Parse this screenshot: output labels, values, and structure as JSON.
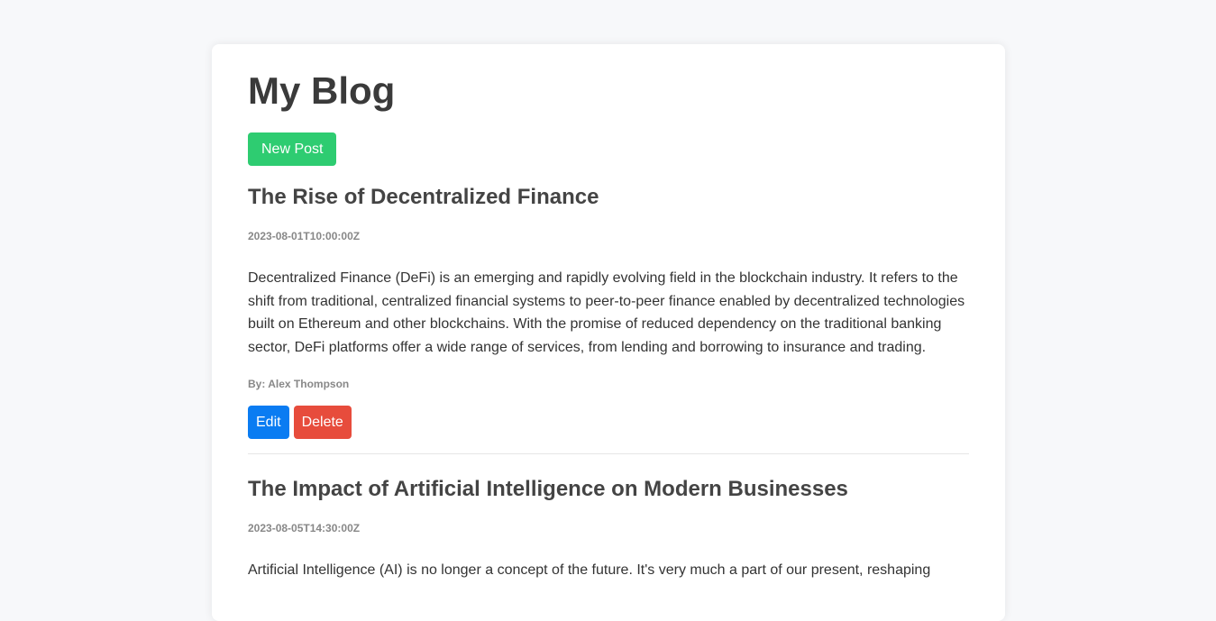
{
  "page": {
    "title": "My Blog",
    "new_post_label": "New Post"
  },
  "posts": [
    {
      "title": "The Rise of Decentralized Finance",
      "date": "2023-08-01T10:00:00Z",
      "body": "Decentralized Finance (DeFi) is an emerging and rapidly evolving field in the blockchain industry. It refers to the shift from traditional, centralized financial systems to peer-to-peer finance enabled by decentralized technologies built on Ethereum and other blockchains. With the promise of reduced dependency on the traditional banking sector, DeFi platforms offer a wide range of services, from lending and borrowing to insurance and trading.",
      "author": "By: Alex Thompson",
      "edit_label": "Edit",
      "delete_label": "Delete"
    },
    {
      "title": "The Impact of Artificial Intelligence on Modern Businesses",
      "date": "2023-08-05T14:30:00Z",
      "body": "Artificial Intelligence (AI) is no longer a concept of the future. It's very much a part of our present, reshaping"
    }
  ],
  "colors": {
    "new_post_button": "#2ecc71",
    "edit_button": "#0a7cf2",
    "delete_button": "#e74c3c",
    "page_background": "#f7f8fa"
  }
}
